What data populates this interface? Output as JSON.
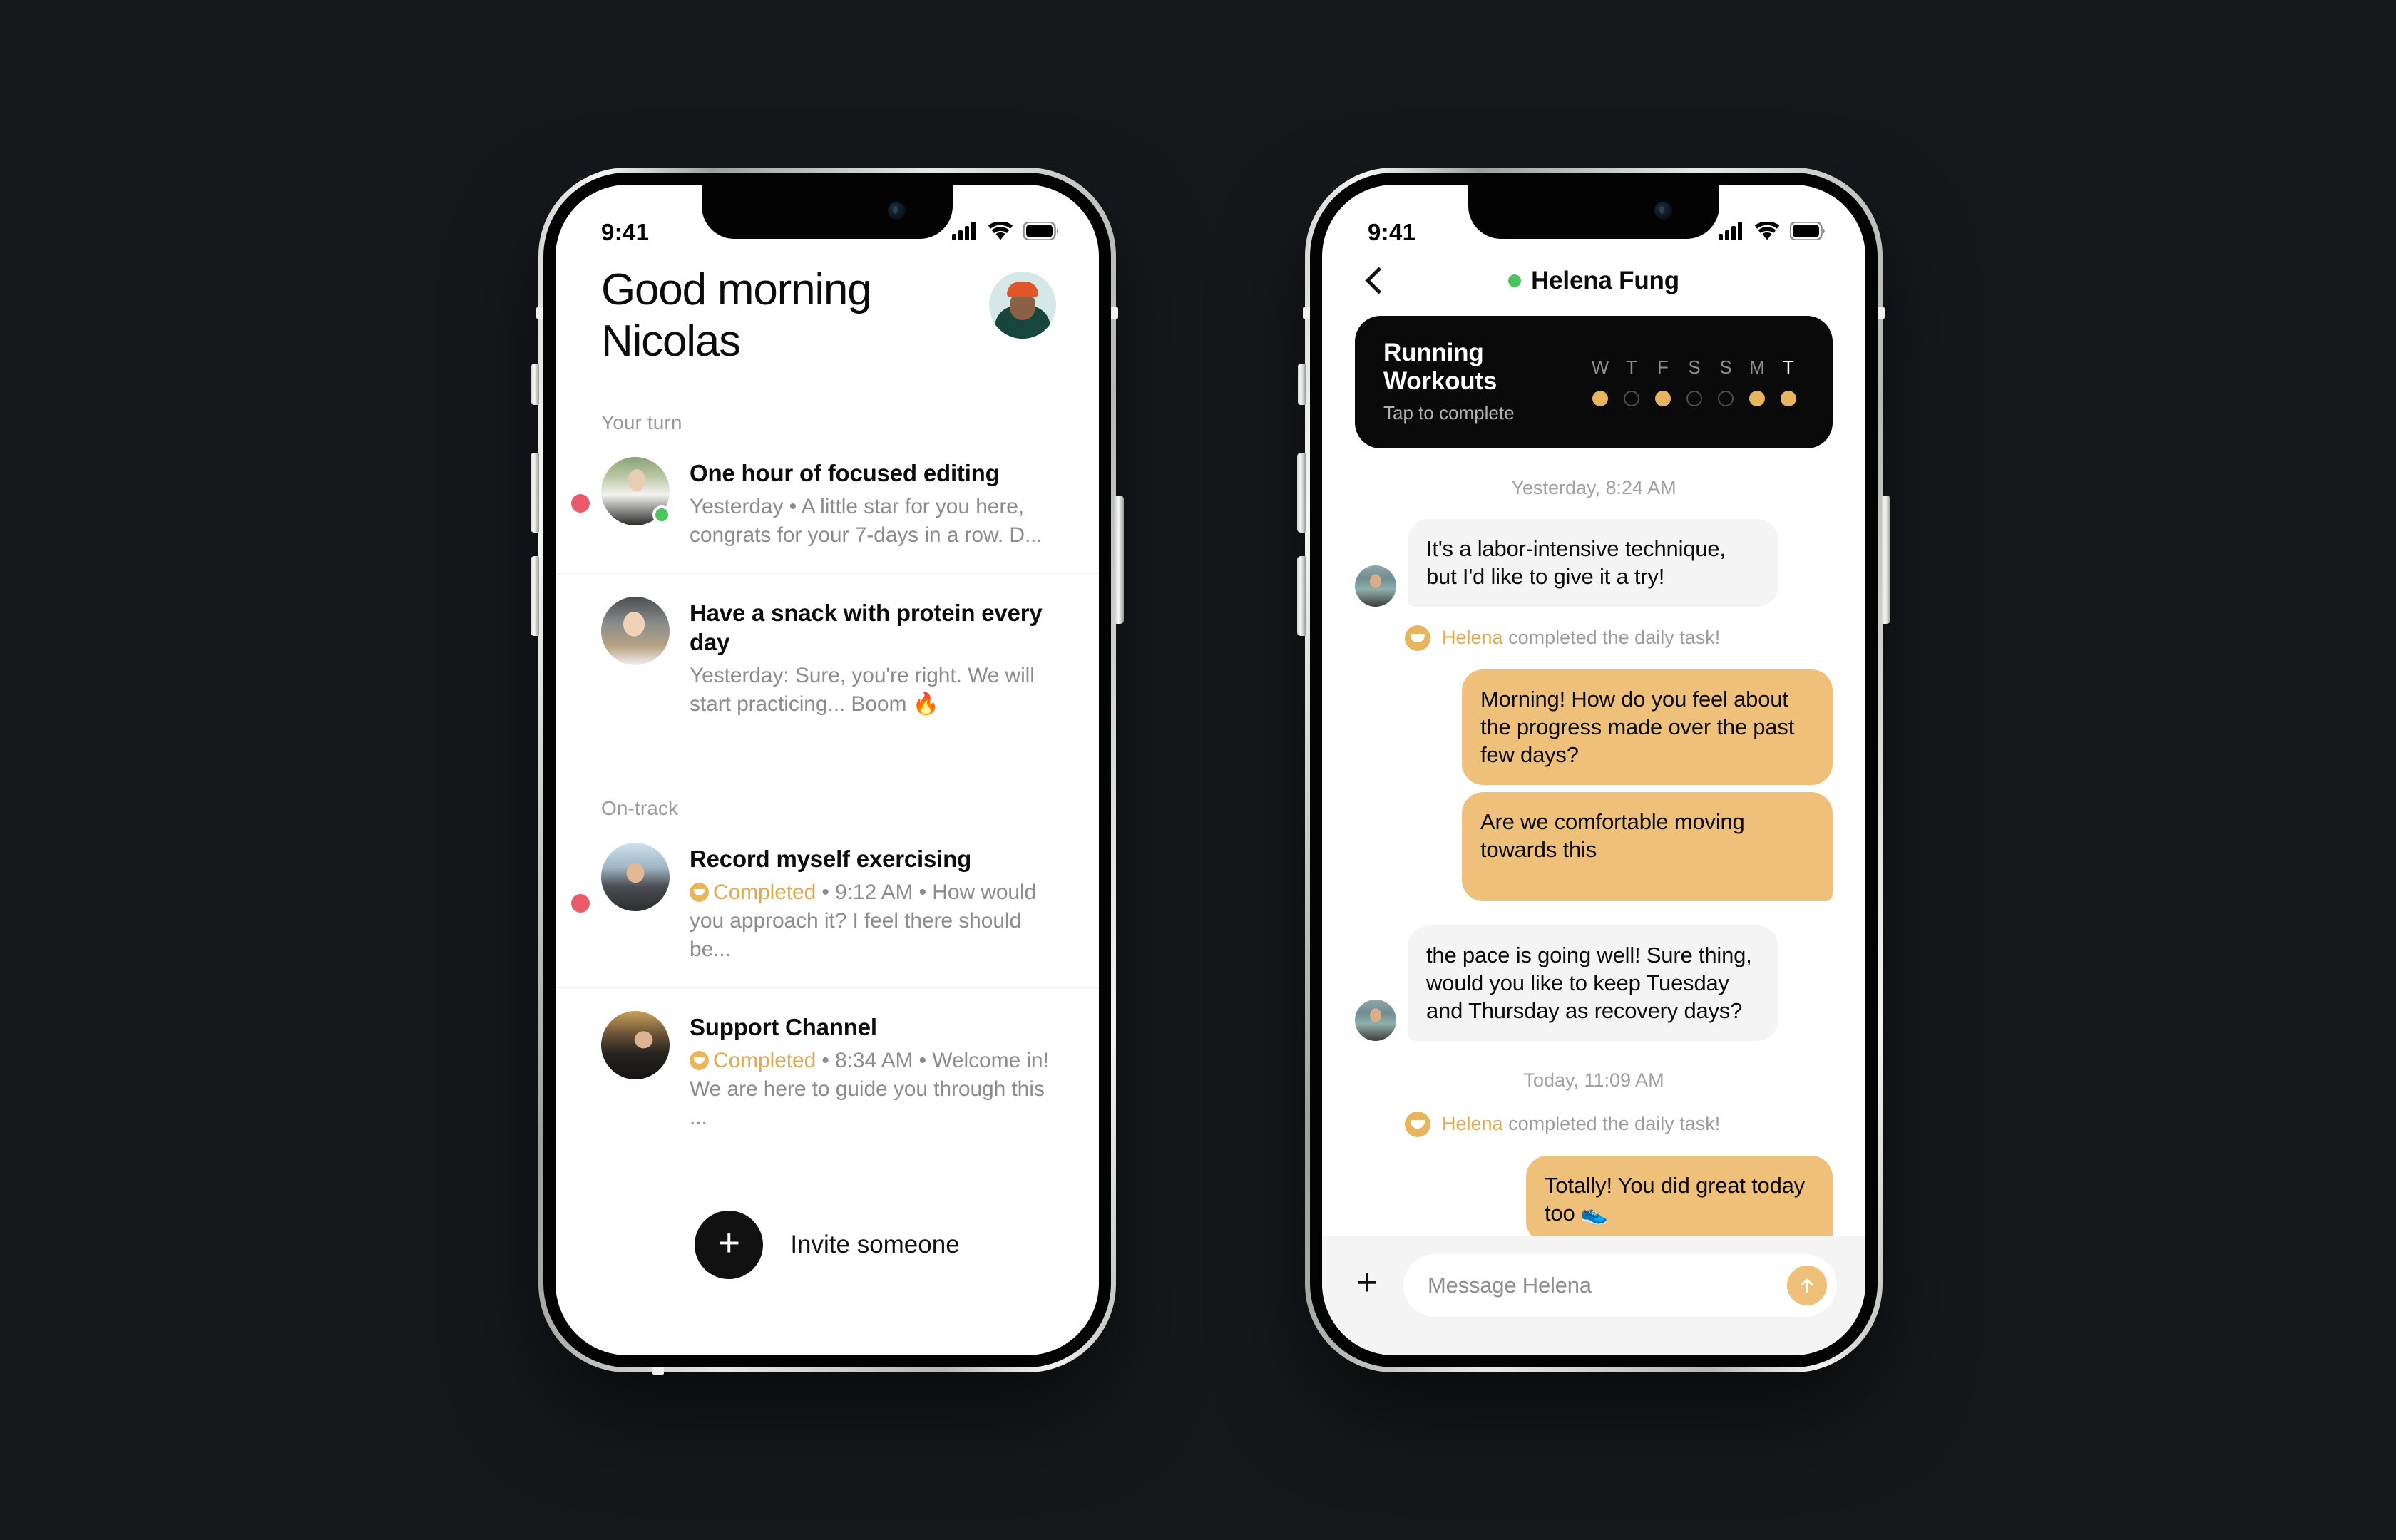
{
  "app": {
    "accent_amber": "#EFC079",
    "accent_amber_text": "#E0A94B",
    "unread_red": "#EB5A68",
    "online_green": "#4CC45C",
    "background": "#17181C"
  },
  "phone_left": {
    "status_bar": {
      "time": "9:41",
      "signal_icon": "cellular-bars-icon",
      "wifi_icon": "wifi-icon",
      "battery_icon": "battery-full-icon"
    },
    "greeting": {
      "line1": "Good morning",
      "line2": "Nicolas",
      "avatar_name": "nicolas-avatar"
    },
    "sections": [
      {
        "label": "Your turn",
        "threads": [
          {
            "title": "One hour of focused editing",
            "preview": "Yesterday • A little star for you here, congrats for your 7-days in a row. D...",
            "unread": true,
            "online": true,
            "completed": false
          },
          {
            "title": "Have a snack with protein every day",
            "preview": "Yesterday: Sure, you're right. We will start practicing... Boom 🔥",
            "unread": false,
            "online": false,
            "completed": false
          }
        ]
      },
      {
        "label": "On-track",
        "threads": [
          {
            "title": "Record myself exercising",
            "completed_label": "Completed",
            "preview": " • 9:12 AM • How would you approach it? I feel there should be...",
            "unread": true,
            "online": false,
            "completed": true
          },
          {
            "title": "Support Channel",
            "completed_label": "Completed",
            "preview": " • 8:34 AM • Welcome in! We are here to guide you through this ...",
            "unread": false,
            "online": false,
            "completed": true
          }
        ]
      }
    ],
    "invite": {
      "label": "Invite someone",
      "plus_icon": "plus-icon"
    }
  },
  "phone_right": {
    "status_bar": {
      "time": "9:41",
      "signal_icon": "cellular-bars-icon",
      "wifi_icon": "wifi-icon",
      "battery_icon": "battery-full-icon"
    },
    "header": {
      "back_icon": "chevron-left-icon",
      "title": "Helena Fung",
      "presence": "online"
    },
    "habit_card": {
      "name": "Running Workouts",
      "subtitle": "Tap to complete",
      "days": [
        {
          "label": "W",
          "done": true
        },
        {
          "label": "T",
          "done": false
        },
        {
          "label": "F",
          "done": true
        },
        {
          "label": "S",
          "done": false
        },
        {
          "label": "S",
          "done": false
        },
        {
          "label": "M",
          "done": true
        },
        {
          "label": "T",
          "done": true
        }
      ]
    },
    "conversation": [
      {
        "kind": "daystamp",
        "text": "Yesterday, 8:24 AM"
      },
      {
        "kind": "message",
        "side": "in",
        "text": "It's a labor-intensive technique, but I'd like to give it a try!",
        "avatar": true
      },
      {
        "kind": "system",
        "who": "Helena",
        "text": " completed the daily task!"
      },
      {
        "kind": "message",
        "side": "out",
        "text": "Morning! How do you feel about the progress made over the past few days?"
      },
      {
        "kind": "message",
        "side": "out",
        "text": "Are we comfortable moving towards this"
      },
      {
        "kind": "message",
        "side": "in",
        "text": "the pace is going well! Sure thing, would you like to keep Tuesday and Thursday as recovery days?",
        "avatar": true
      },
      {
        "kind": "daystamp",
        "text": "Today, 11:09 AM"
      },
      {
        "kind": "system",
        "who": "Helena",
        "text": " completed the daily task!"
      },
      {
        "kind": "message",
        "side": "out",
        "text": "Totally! You did great today too 👟"
      }
    ],
    "composer": {
      "plus_icon": "plus-icon",
      "placeholder": "Message Helena",
      "send_icon": "arrow-up-icon"
    }
  }
}
